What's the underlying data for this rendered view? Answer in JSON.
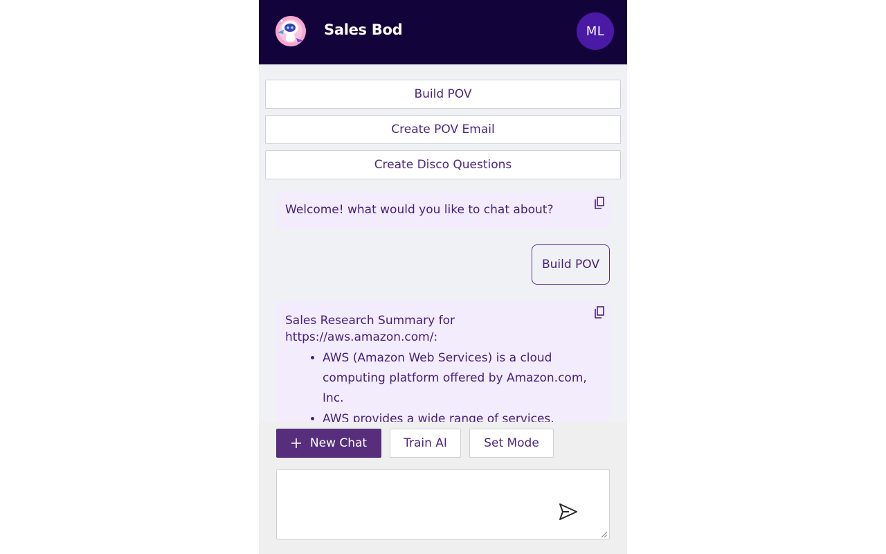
{
  "header": {
    "title": "Sales Bod",
    "logo_icon": "robot-logo-icon",
    "avatar_initials": "ML",
    "colors": {
      "background": "#12043a",
      "avatar": "#4a1aa6"
    }
  },
  "quick_actions": [
    {
      "label": "Build POV"
    },
    {
      "label": "Create POV Email"
    },
    {
      "label": "Create Disco Questions"
    }
  ],
  "chat": {
    "messages": [
      {
        "role": "bot",
        "text": "Welcome! what would you like to chat about?"
      },
      {
        "role": "user",
        "text": "Build POV"
      },
      {
        "role": "bot",
        "intro": "Sales Research Summary for https://aws.amazon.com/:",
        "bullets": [
          "AWS (Amazon Web Services) is a cloud computing platform offered by Amazon.com, Inc.",
          "AWS provides a wide range of services, including computation power, storage, and"
        ]
      }
    ]
  },
  "toolbar": {
    "new_chat_icon": "plus-icon",
    "new_chat_label": "New Chat",
    "train_label": "Train AI",
    "mode_label": "Set Mode"
  },
  "composer": {
    "value": "",
    "send_icon": "send-icon"
  },
  "colors": {
    "accent": "#562e7c",
    "text": "#47207a",
    "bot_bubble": "#f3ecfd",
    "app_background": "#f0f1f5"
  }
}
